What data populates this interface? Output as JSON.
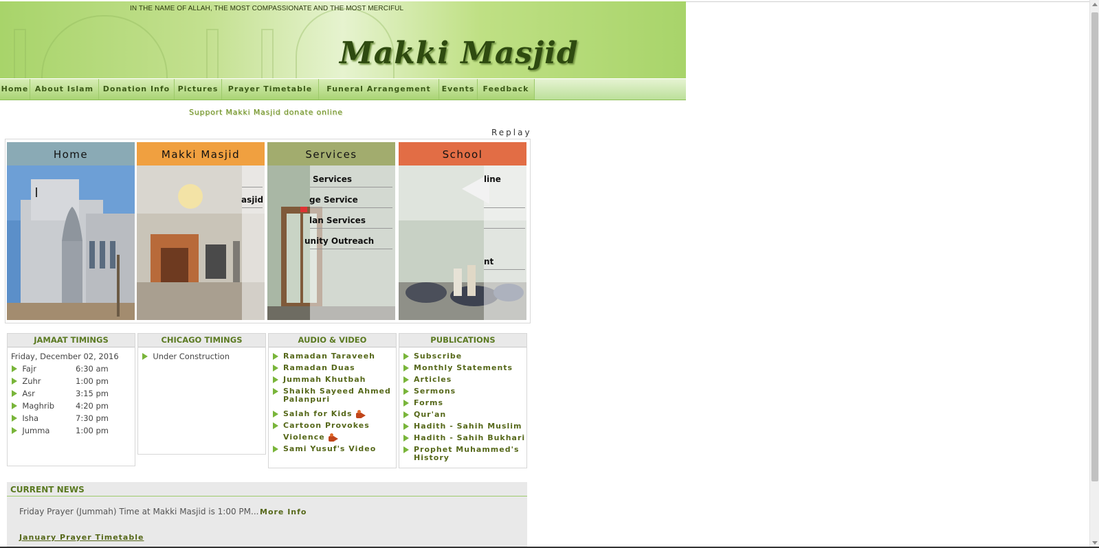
{
  "header": {
    "basmala": "IN THE NAME OF ALLAH, THE MOST COMPASSIONATE AND THE MOST MERCIFUL",
    "logo": "Makki Masjid"
  },
  "nav": {
    "items": [
      "Home",
      "About Islam",
      "Donation Info",
      "Pictures",
      "Prayer Timetable",
      "Funeral Arrangement",
      "Events",
      "Feedback"
    ]
  },
  "donate_link": "Support Makki Masjid donate online",
  "replay": "Replay",
  "panels": [
    {
      "title": "Home",
      "color": "#8aaab5",
      "links": []
    },
    {
      "title": "Makki Masjid",
      "color": "#f0a040",
      "links": [
        "asjid"
      ]
    },
    {
      "title": "Services",
      "color": "#a2ac6e",
      "links": [
        "Services",
        "ge Service",
        "lan Services",
        "unity Outreach"
      ]
    },
    {
      "title": "School",
      "color": "#e26d45",
      "links": [
        "line",
        "nt"
      ]
    }
  ],
  "jamaat": {
    "title": "JAMAAT TIMINGS",
    "date": "Friday, December 02, 2016",
    "rows": [
      {
        "name": "Fajr",
        "time": "6:30 am"
      },
      {
        "name": "Zuhr",
        "time": "1:00 pm"
      },
      {
        "name": "Asr",
        "time": "3:15 pm"
      },
      {
        "name": "Maghrib",
        "time": "4:20 pm"
      },
      {
        "name": "Isha",
        "time": "7:30 pm"
      },
      {
        "name": "Jumma",
        "time": "1:00 pm"
      }
    ]
  },
  "chicago": {
    "title": "CHICAGO TIMINGS",
    "items": [
      "Under Construction"
    ]
  },
  "audio": {
    "title": "AUDIO & VIDEO",
    "items": [
      "Ramadan Taraveeh",
      "Ramadan Duas",
      "Jummah Khutbah",
      "Shaikh Sayeed Ahmed",
      "Palanpuri",
      "Salah for Kids",
      "Cartoon Provokes",
      "Violence",
      "Sami Yusuf's Video"
    ]
  },
  "publications": {
    "title": "PUBLICATIONS",
    "items": [
      "Subscribe",
      "Monthly Statements",
      "Articles",
      "Sermons",
      "Forms",
      "Qur'an",
      "Hadith - Sahih Muslim",
      "Hadith - Sahih Bukhari",
      "Prophet Muhammed's",
      "History"
    ]
  },
  "news": {
    "title": "CURRENT NEWS",
    "text": "Friday Prayer (Jummah) Time at Makki Masjid is 1:00 PM...",
    "more": "More Info",
    "link": "January Prayer Timetable"
  }
}
